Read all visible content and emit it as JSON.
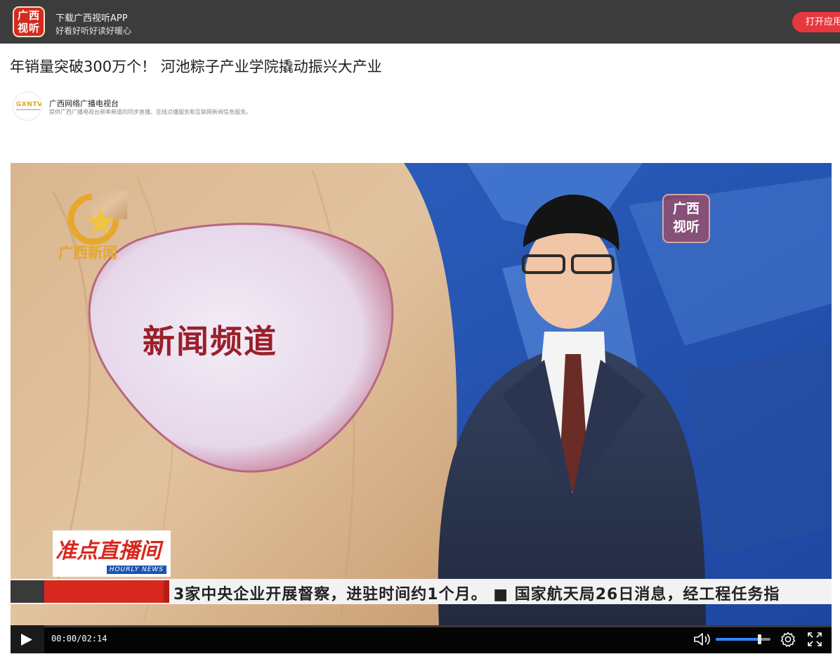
{
  "banner": {
    "logo_line1": "广西",
    "logo_line2": "视听",
    "title": "下载广西视听APP",
    "subtitle": "好看好听好读好暖心",
    "open_label": "打开应用"
  },
  "article": {
    "headline": "年销量突破300万个！ 河池粽子产业学院撬动振兴大产业",
    "author": {
      "avatar_text": "GXNTV",
      "name": "广西网络广播电视台",
      "description": "提供广西广播电视台频率频道的同步直播、在线点播服务和互联网新闻信息服务。"
    }
  },
  "video": {
    "overlay": {
      "station_logo_text": "广西新闻",
      "channel_text": "新闻频道",
      "corner_logo_line1": "广西",
      "corner_logo_line2": "视听",
      "program_tag": "准点直播间",
      "program_tag_en": "HOURLY NEWS",
      "ticker": "3家中央企业开展督察，进驻时间约1个月。  ■ 国家航天局26日消息，经工程任务指"
    },
    "controls": {
      "time": "00:00/02:14",
      "progress": 0.0,
      "volume": 0.8
    }
  },
  "colors": {
    "banner_bg": "#3c3c3c",
    "open_button": "#e8373e",
    "accent_blue": "#2a8cff"
  },
  "icons": [
    "play-icon",
    "volume-icon",
    "gear-icon",
    "fullscreen-icon"
  ]
}
